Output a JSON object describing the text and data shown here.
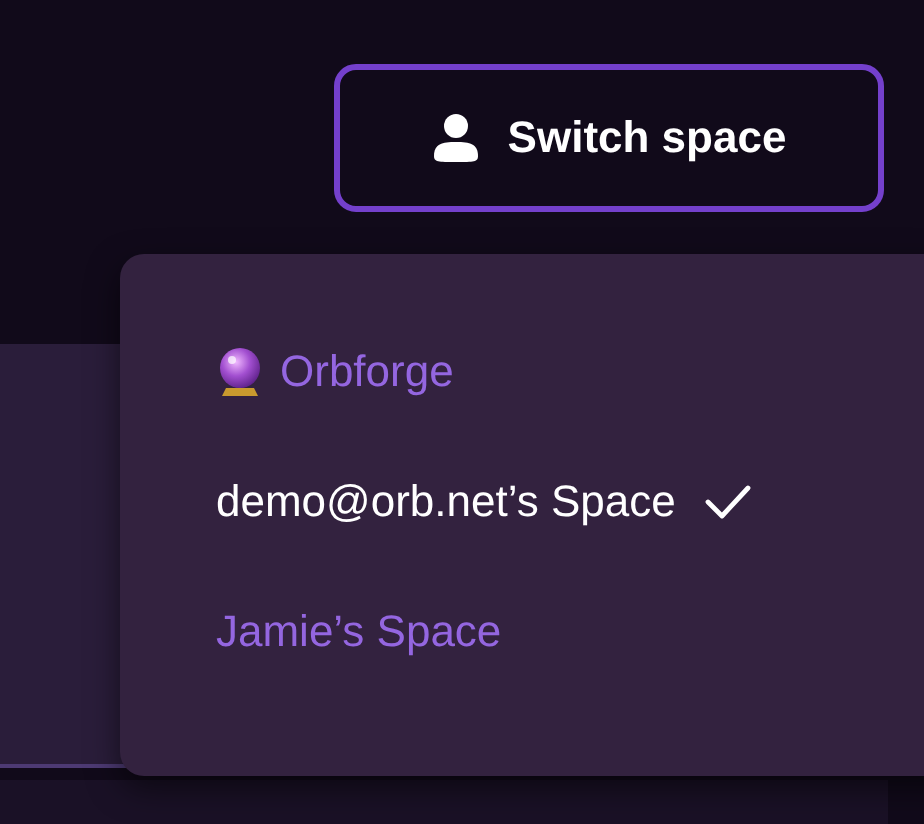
{
  "switch_button": {
    "label": "Switch space"
  },
  "space_menu": {
    "items": [
      {
        "kind": "team",
        "label": "Orbforge",
        "selected": false
      },
      {
        "kind": "personal",
        "label": "demo@orb.net’s Space",
        "selected": true
      },
      {
        "kind": "personal",
        "label": "Jamie’s Space",
        "selected": false
      }
    ]
  }
}
